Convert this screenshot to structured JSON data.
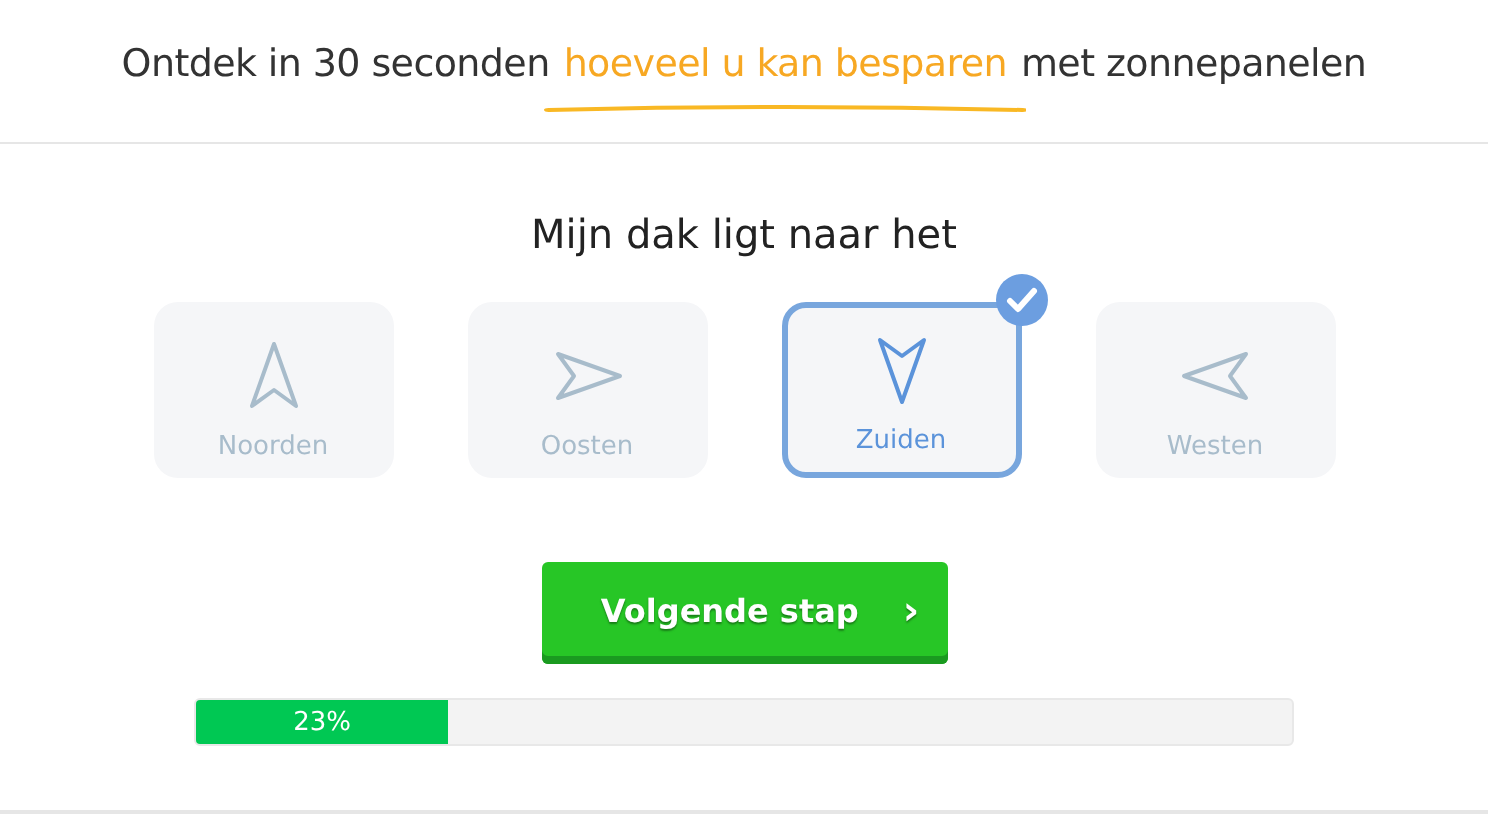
{
  "headline": {
    "before": "Ontdek in 30 seconden",
    "highlight": "hoeveel u kan besparen",
    "after": "met zonnepanelen"
  },
  "question": "Mijn dak ligt naar het",
  "options": [
    {
      "label": "Noorden",
      "kind": "north",
      "selected": false
    },
    {
      "label": "Oosten",
      "kind": "east",
      "selected": false
    },
    {
      "label": "Zuiden",
      "kind": "south",
      "selected": true
    },
    {
      "label": "Westen",
      "kind": "west",
      "selected": false
    }
  ],
  "next_button": {
    "label": "Volgende stap",
    "icon": "›"
  },
  "progress": {
    "level": 0.23,
    "reading": "23%"
  }
}
